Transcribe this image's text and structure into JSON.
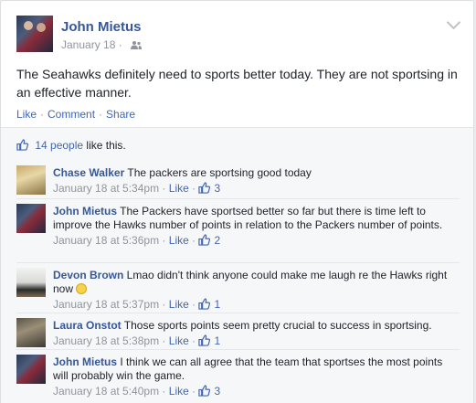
{
  "post": {
    "author": "John Mietus",
    "date": "January 18",
    "separator": "·",
    "text": "The Seahawks definitely need to sports better today. They are not sportsing in an effective manner.",
    "actions": [
      "Like",
      "Comment",
      "Share"
    ]
  },
  "likes": {
    "count_text": "14 people",
    "suffix": " like this."
  },
  "comments": [
    {
      "name": "Chase Walker",
      "text": " The packers are sportsing good today",
      "time": "January 18 at 5:34pm",
      "like_label": "Like",
      "like_count": "3"
    },
    {
      "name": "John Mietus",
      "text": " The Packers have sportsed better so far but there is time left to improve the Hawks number of points in relation to the Packers number of points.",
      "time": "January 18 at 5:36pm",
      "like_label": "Like",
      "like_count": "2"
    },
    {
      "name": "Devon Brown",
      "text": " Lmao didn't think anyone could make me laugh re the Hawks right now ",
      "time": "January 18 at 5:37pm",
      "like_label": "Like",
      "like_count": "1"
    },
    {
      "name": "Laura Onstot",
      "text": " Those sports points seem pretty crucial to success in sportsing.",
      "time": "January 18 at 5:38pm",
      "like_label": "Like",
      "like_count": "1"
    },
    {
      "name": "John Mietus",
      "text": " I think we can all agree that the team that sportses the most points will probably win the game.",
      "time": "January 18 at 5:40pm",
      "like_label": "Like",
      "like_count": "3"
    }
  ],
  "meta_separator": "·",
  "colors": {
    "link": "#4267b2",
    "name": "#365899",
    "muted": "#90949c",
    "comment_bg": "#f6f7f9"
  },
  "icons": [
    "audience-friends-icon",
    "chevron-down-icon",
    "thumbs-up-icon",
    "smiley-emoji-icon"
  ]
}
